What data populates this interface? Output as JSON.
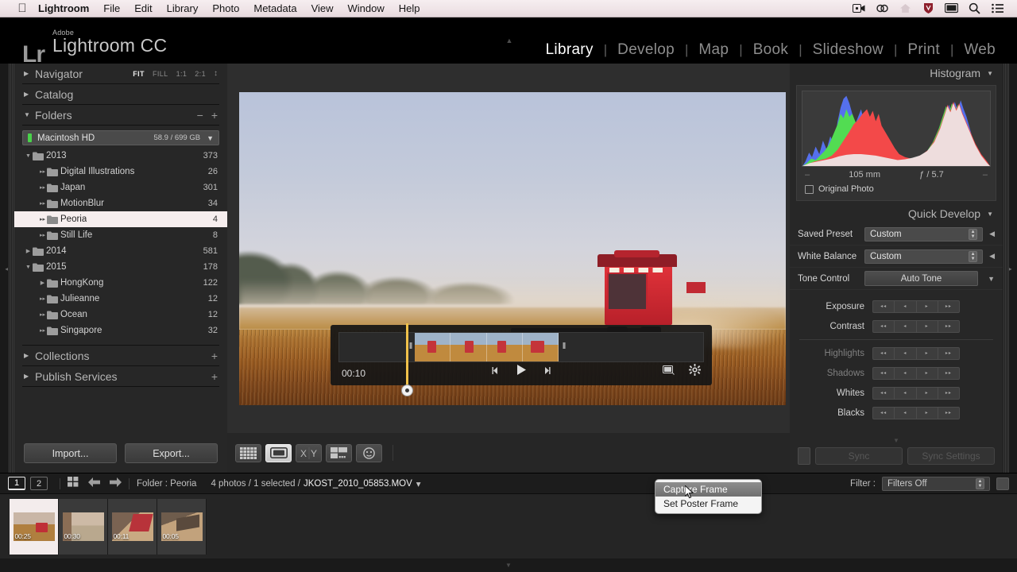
{
  "macbar": {
    "apple": "apple-logo",
    "menus": [
      "Lightroom",
      "File",
      "Edit",
      "Library",
      "Photo",
      "Metadata",
      "View",
      "Window",
      "Help"
    ],
    "status_icons": [
      "screen-record-icon",
      "creative-cloud-icon",
      "dropbox-icon",
      "shield-icon",
      "display-icon",
      "search-icon",
      "list-icon"
    ]
  },
  "titlebar": {
    "logo_mark": "Lr",
    "brand_line1": "Adobe",
    "brand_line2": "Lightroom CC",
    "modules": [
      "Library",
      "Develop",
      "Map",
      "Book",
      "Slideshow",
      "Print",
      "Web"
    ],
    "active_module": "Library"
  },
  "left_panel": {
    "navigator": {
      "title": "Navigator",
      "zoom_levels": [
        "FIT",
        "FILL",
        "1:1",
        "2:1"
      ],
      "active_zoom": "FIT"
    },
    "catalog": {
      "title": "Catalog"
    },
    "folders": {
      "title": "Folders",
      "minus": "−",
      "plus": "+",
      "volume": {
        "name": "Macintosh HD",
        "space": "58.9 / 699 GB",
        "led_color": "#49d24a"
      },
      "tree": [
        {
          "name": "2013",
          "count": "373",
          "indent": 0,
          "state": "expanded",
          "selected": false
        },
        {
          "name": "Digital Illustrations",
          "count": "26",
          "indent": 1,
          "state": "leaf",
          "selected": false
        },
        {
          "name": "Japan",
          "count": "301",
          "indent": 1,
          "state": "leaf",
          "selected": false
        },
        {
          "name": "MotionBlur",
          "count": "34",
          "indent": 1,
          "state": "leaf",
          "selected": false
        },
        {
          "name": "Peoria",
          "count": "4",
          "indent": 1,
          "state": "leaf",
          "selected": true
        },
        {
          "name": "Still Life",
          "count": "8",
          "indent": 1,
          "state": "leaf",
          "selected": false
        },
        {
          "name": "2014",
          "count": "581",
          "indent": 0,
          "state": "collapsed",
          "selected": false
        },
        {
          "name": "2015",
          "count": "178",
          "indent": 0,
          "state": "expanded",
          "selected": false
        },
        {
          "name": "HongKong",
          "count": "122",
          "indent": 1,
          "state": "collapsed",
          "selected": false
        },
        {
          "name": "Julieanne",
          "count": "12",
          "indent": 1,
          "state": "leaf",
          "selected": false
        },
        {
          "name": "Ocean",
          "count": "12",
          "indent": 1,
          "state": "leaf",
          "selected": false
        },
        {
          "name": "Singapore",
          "count": "32",
          "indent": 1,
          "state": "leaf",
          "selected": false
        }
      ]
    },
    "collections": {
      "title": "Collections",
      "plus": "+"
    },
    "publish_services": {
      "title": "Publish Services",
      "plus": "+"
    },
    "import_label": "Import...",
    "export_label": "Export..."
  },
  "video": {
    "current_time": "00:10",
    "trim_start_handle": "‖",
    "trim_end_handle": "‖",
    "prev_frame": "prev-frame-icon",
    "play": "play-icon",
    "next_frame": "next-frame-icon",
    "frame_capture": "frame-capture-icon",
    "settings_gear": "gear-icon"
  },
  "context_menu": {
    "items": [
      {
        "label": "Capture Frame",
        "highlighted": true
      },
      {
        "label": "Set Poster Frame",
        "highlighted": false
      }
    ]
  },
  "center_toolbar": {
    "views": [
      {
        "name": "grid-view-button",
        "active": false
      },
      {
        "name": "loupe-view-button",
        "active": true
      },
      {
        "name": "compare-view-button",
        "active": false
      },
      {
        "name": "survey-view-button",
        "active": false
      },
      {
        "name": "people-view-button",
        "active": false
      }
    ]
  },
  "right_panel": {
    "histogram": {
      "title": "Histogram",
      "focal_length": "105 mm",
      "aperture": "ƒ / 5.7",
      "left_dash": "–",
      "right_dash": "–",
      "original_photo_label": "Original Photo"
    },
    "quick_develop": {
      "title": "Quick Develop",
      "saved_preset": {
        "label": "Saved Preset",
        "value": "Custom"
      },
      "white_balance": {
        "label": "White Balance",
        "value": "Custom"
      },
      "tone_control": {
        "label": "Tone Control",
        "button": "Auto Tone"
      },
      "adjustments": [
        {
          "label": "Exposure",
          "dimmed": false
        },
        {
          "label": "Contrast",
          "dimmed": false
        },
        {
          "label": "Highlights",
          "dimmed": true
        },
        {
          "label": "Shadows",
          "dimmed": true
        },
        {
          "label": "Whites",
          "dimmed": false
        },
        {
          "label": "Blacks",
          "dimmed": false
        }
      ],
      "arrow_marks": [
        "◂◂",
        "◂",
        "▸",
        "▸▸"
      ]
    },
    "sync": {
      "sync_label": "Sync",
      "sync_settings_label": "Sync Settings"
    }
  },
  "status_bar": {
    "page_buttons": [
      "1",
      "2"
    ],
    "grid_icon": "grid-toggle-icon",
    "back_arrow": "back-arrow-icon",
    "forward_arrow": "forward-arrow-icon",
    "folder_label": "Folder : Peoria",
    "selection_text": "4 photos / 1 selected /",
    "filename": "JKOST_2010_05853.MOV",
    "filename_caret": "▾",
    "filter_label": "Filter :",
    "filter_value": "Filters Off"
  },
  "filmstrip": {
    "thumbnails": [
      {
        "duration": "00:25",
        "selected": true
      },
      {
        "duration": "00:30",
        "selected": false
      },
      {
        "duration": "00:11",
        "selected": false
      },
      {
        "duration": "00:05",
        "selected": false
      }
    ]
  },
  "colors": {
    "panel_bg": "#272727",
    "selection_bg": "#f6eeee",
    "accent_green": "#49d24a",
    "combine_red": "#c4343a"
  }
}
